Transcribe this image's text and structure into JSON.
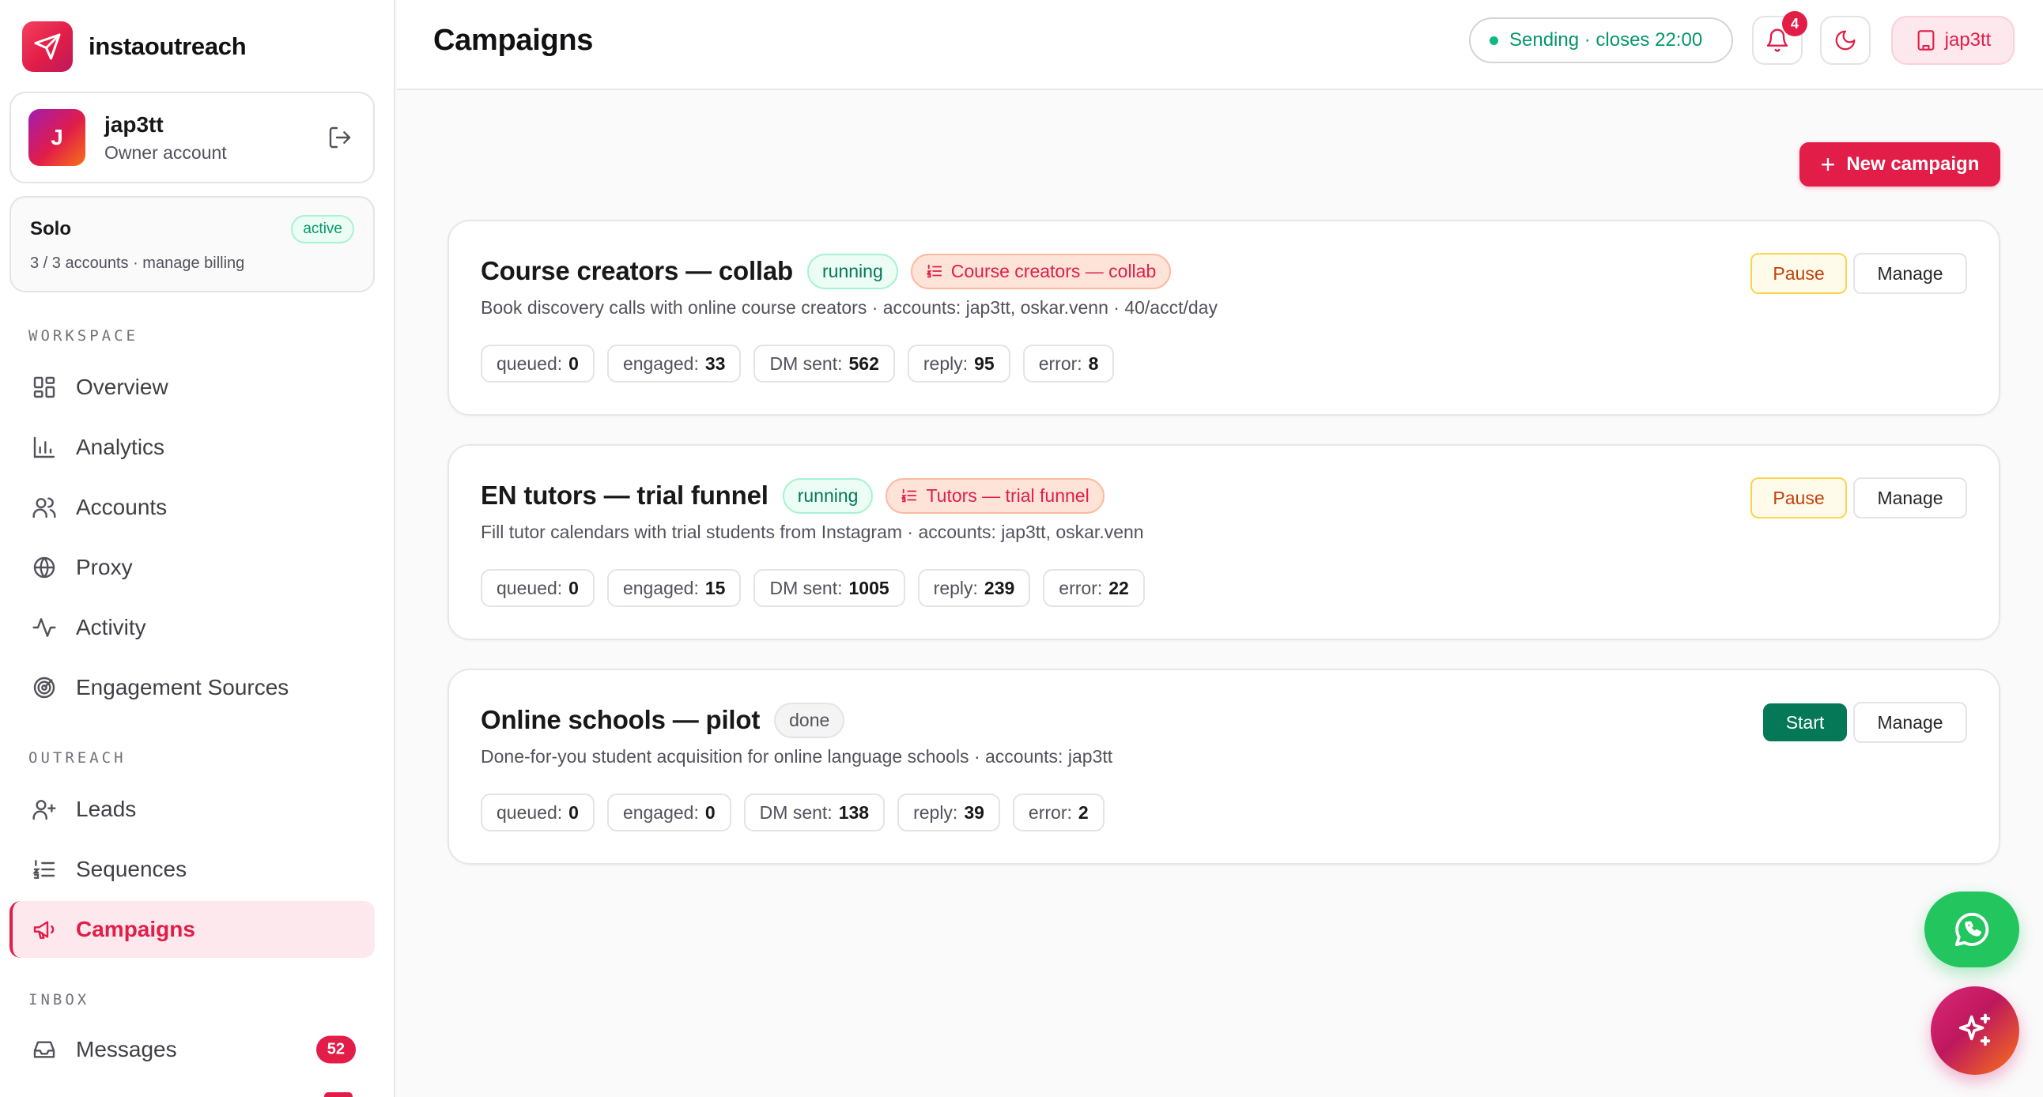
{
  "app": {
    "brand_name": "instaoutreach",
    "accent_color": "#e11d48"
  },
  "user": {
    "avatar_initial": "J",
    "name": "jap3tt",
    "role": "Owner account"
  },
  "plan": {
    "name": "Solo",
    "status": "active",
    "details": "3 / 3 accounts · manage billing"
  },
  "sidebar": {
    "sections": {
      "workspace": "WORKSPACE",
      "outreach": "OUTREACH",
      "inbox": "INBOX"
    },
    "items": [
      {
        "label": "Overview",
        "icon": "grid-icon"
      },
      {
        "label": "Analytics",
        "icon": "bar-chart-icon"
      },
      {
        "label": "Accounts",
        "icon": "users-icon"
      },
      {
        "label": "Proxy",
        "icon": "globe-icon"
      },
      {
        "label": "Activity",
        "icon": "pulse-icon"
      },
      {
        "label": "Engagement Sources",
        "icon": "target-icon"
      },
      {
        "label": "Leads",
        "icon": "user-plus-icon"
      },
      {
        "label": "Sequences",
        "icon": "list-ordered-icon"
      },
      {
        "label": "Campaigns",
        "icon": "megaphone-icon",
        "active": true
      },
      {
        "label": "Messages",
        "icon": "inbox-icon",
        "badge": "52"
      }
    ]
  },
  "header": {
    "title": "Campaigns",
    "status": "Sending · closes 22:00",
    "notifications_count": "4",
    "org_name": "jap3tt"
  },
  "main": {
    "new_campaign_label": "New campaign",
    "campaigns": [
      {
        "title": "Course creators — collab",
        "status": "running",
        "sequence": "Course creators — collab",
        "description": "Book discovery calls with online course creators · accounts: jap3tt, oskar.venn · 40/acct/day",
        "stats": [
          {
            "label": "queued:",
            "value": "0"
          },
          {
            "label": "engaged:",
            "value": "33"
          },
          {
            "label": "DM sent:",
            "value": "562"
          },
          {
            "label": "reply:",
            "value": "95"
          },
          {
            "label": "error:",
            "value": "8"
          }
        ],
        "primary_action": "Pause",
        "secondary_action": "Manage"
      },
      {
        "title": "EN tutors — trial funnel",
        "status": "running",
        "sequence": "Tutors — trial funnel",
        "description": "Fill tutor calendars with trial students from Instagram · accounts: jap3tt, oskar.venn",
        "stats": [
          {
            "label": "queued:",
            "value": "0"
          },
          {
            "label": "engaged:",
            "value": "15"
          },
          {
            "label": "DM sent:",
            "value": "1005"
          },
          {
            "label": "reply:",
            "value": "239"
          },
          {
            "label": "error:",
            "value": "22"
          }
        ],
        "primary_action": "Pause",
        "secondary_action": "Manage"
      },
      {
        "title": "Online schools — pilot",
        "status": "done",
        "description": "Done-for-you student acquisition for online language schools · accounts: jap3tt",
        "stats": [
          {
            "label": "queued:",
            "value": "0"
          },
          {
            "label": "engaged:",
            "value": "0"
          },
          {
            "label": "DM sent:",
            "value": "138"
          },
          {
            "label": "reply:",
            "value": "39"
          },
          {
            "label": "error:",
            "value": "2"
          }
        ],
        "primary_action": "Start",
        "secondary_action": "Manage"
      }
    ]
  },
  "floating": {
    "whatsapp_icon": "whatsapp-icon",
    "assistant_icon": "sparkles-icon"
  }
}
